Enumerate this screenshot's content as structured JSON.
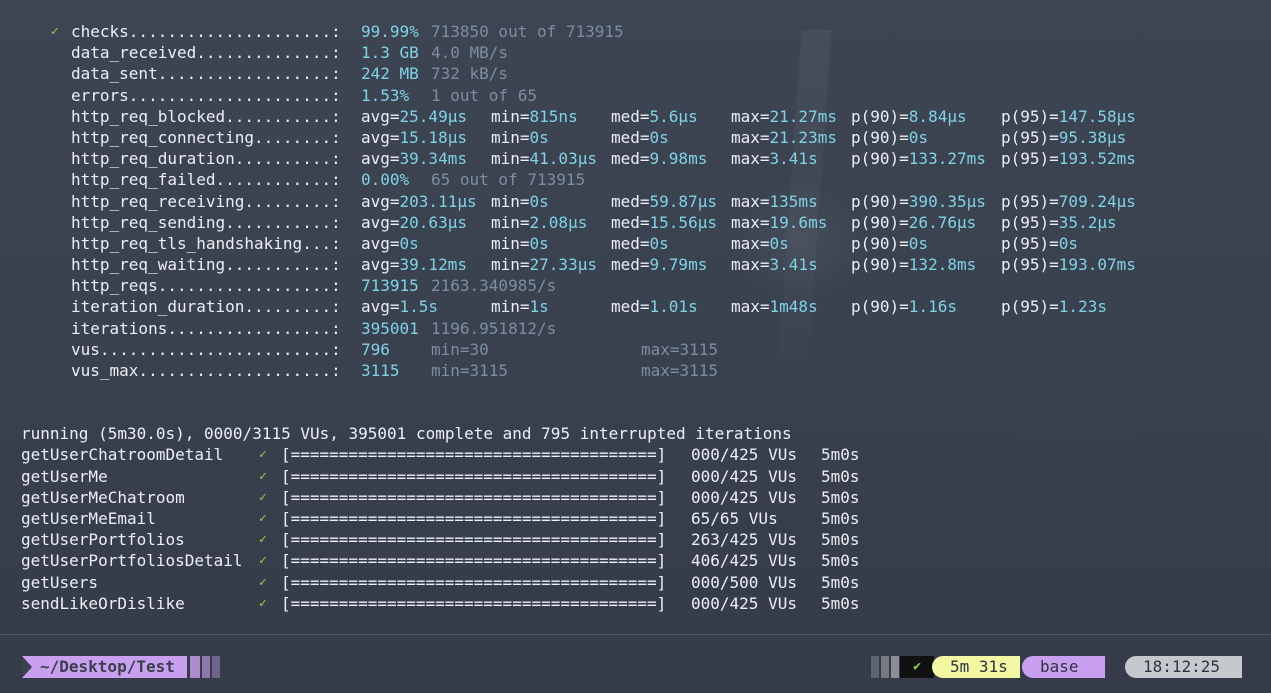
{
  "metrics": [
    {
      "check": "✓",
      "name": "checks.....................:",
      "cols": [
        {
          "t": "99.99%",
          "c": "val"
        },
        {
          "t": "713850 out of 713915",
          "c": "dim"
        }
      ]
    },
    {
      "name": "data_received..............:",
      "cols": [
        {
          "t": "1.3 GB",
          "c": "val"
        },
        {
          "t": "4.0 MB/s",
          "c": "dim"
        }
      ]
    },
    {
      "name": "data_sent..................:",
      "cols": [
        {
          "t": "242 MB",
          "c": "val"
        },
        {
          "t": "732 kB/s",
          "c": "dim"
        }
      ]
    },
    {
      "name": "errors.....................:",
      "cols": [
        {
          "t": "1.53%",
          "c": "val"
        },
        {
          "t": "1 out of 65",
          "c": "dim"
        }
      ]
    },
    {
      "name": "http_req_blocked...........:",
      "stats": [
        "avg=25.49µs",
        "min=815ns",
        "med=5.6µs",
        "max=21.27ms",
        "p(90)=8.84µs",
        "p(95)=147.58µs"
      ]
    },
    {
      "name": "http_req_connecting........:",
      "stats": [
        "avg=15.18µs",
        "min=0s",
        "med=0s",
        "max=21.23ms",
        "p(90)=0s",
        "p(95)=95.38µs"
      ]
    },
    {
      "name": "http_req_duration..........:",
      "stats": [
        "avg=39.34ms",
        "min=41.03µs",
        "med=9.98ms",
        "max=3.41s",
        "p(90)=133.27ms",
        "p(95)=193.52ms"
      ]
    },
    {
      "name": "http_req_failed............:",
      "cols": [
        {
          "t": "0.00%",
          "c": "val"
        },
        {
          "t": "65 out of 713915",
          "c": "dim"
        }
      ]
    },
    {
      "name": "http_req_receiving.........:",
      "stats": [
        "avg=203.11µs",
        "min=0s",
        "med=59.87µs",
        "max=135ms",
        "p(90)=390.35µs",
        "p(95)=709.24µs"
      ]
    },
    {
      "name": "http_req_sending...........:",
      "stats": [
        "avg=20.63µs",
        "min=2.08µs",
        "med=15.56µs",
        "max=19.6ms",
        "p(90)=26.76µs",
        "p(95)=35.2µs"
      ]
    },
    {
      "name": "http_req_tls_handshaking...:",
      "stats": [
        "avg=0s",
        "min=0s",
        "med=0s",
        "max=0s",
        "p(90)=0s",
        "p(95)=0s"
      ]
    },
    {
      "name": "http_req_waiting...........:",
      "stats": [
        "avg=39.12ms",
        "min=27.33µs",
        "med=9.79ms",
        "max=3.41s",
        "p(90)=132.8ms",
        "p(95)=193.07ms"
      ]
    },
    {
      "name": "http_reqs..................:",
      "cols": [
        {
          "t": "713915",
          "c": "val"
        },
        {
          "t": "2163.340985/s",
          "c": "dim"
        }
      ]
    },
    {
      "name": "iteration_duration.........:",
      "stats": [
        "avg=1.5s",
        "min=1s",
        "med=1.01s",
        "max=1m48s",
        "p(90)=1.16s",
        "p(95)=1.23s"
      ]
    },
    {
      "name": "iterations.................:",
      "cols": [
        {
          "t": "395001",
          "c": "val"
        },
        {
          "t": "1196.951812/s",
          "c": "dim"
        }
      ]
    },
    {
      "name": "vus........................:",
      "vus": [
        "796",
        "min=30",
        "max=3115"
      ]
    },
    {
      "name": "vus_max....................:",
      "vus": [
        "3115",
        "min=3115",
        "max=3115"
      ]
    }
  ],
  "running": "running (5m30.0s), 0000/3115 VUs, 395001 complete and 795 interrupted iterations",
  "scenarios": [
    {
      "name": "getUserChatroomDetail",
      "vus": "000/425 VUs",
      "time": "5m0s"
    },
    {
      "name": "getUserMe",
      "vus": "000/425 VUs",
      "time": "5m0s"
    },
    {
      "name": "getUserMeChatroom",
      "vus": "000/425 VUs",
      "time": "5m0s"
    },
    {
      "name": "getUserMeEmail",
      "vus": "65/65 VUs",
      "time": "5m0s"
    },
    {
      "name": "getUserPortfolios",
      "vus": "263/425 VUs",
      "time": "5m0s"
    },
    {
      "name": "getUserPortfoliosDetail",
      "vus": "406/425 VUs",
      "time": "5m0s"
    },
    {
      "name": "getUsers",
      "vus": "000/500 VUs",
      "time": "5m0s"
    },
    {
      "name": "sendLikeOrDislike",
      "vus": "000/425 VUs",
      "time": "5m0s"
    }
  ],
  "scenario_check": "✓",
  "progress_bar": "[======================================]",
  "prompt": {
    "directory": "~/Desktop/Test",
    "status_icon": "✔",
    "duration": "5m 31s",
    "env": "base",
    "clock": "18:12:25"
  }
}
